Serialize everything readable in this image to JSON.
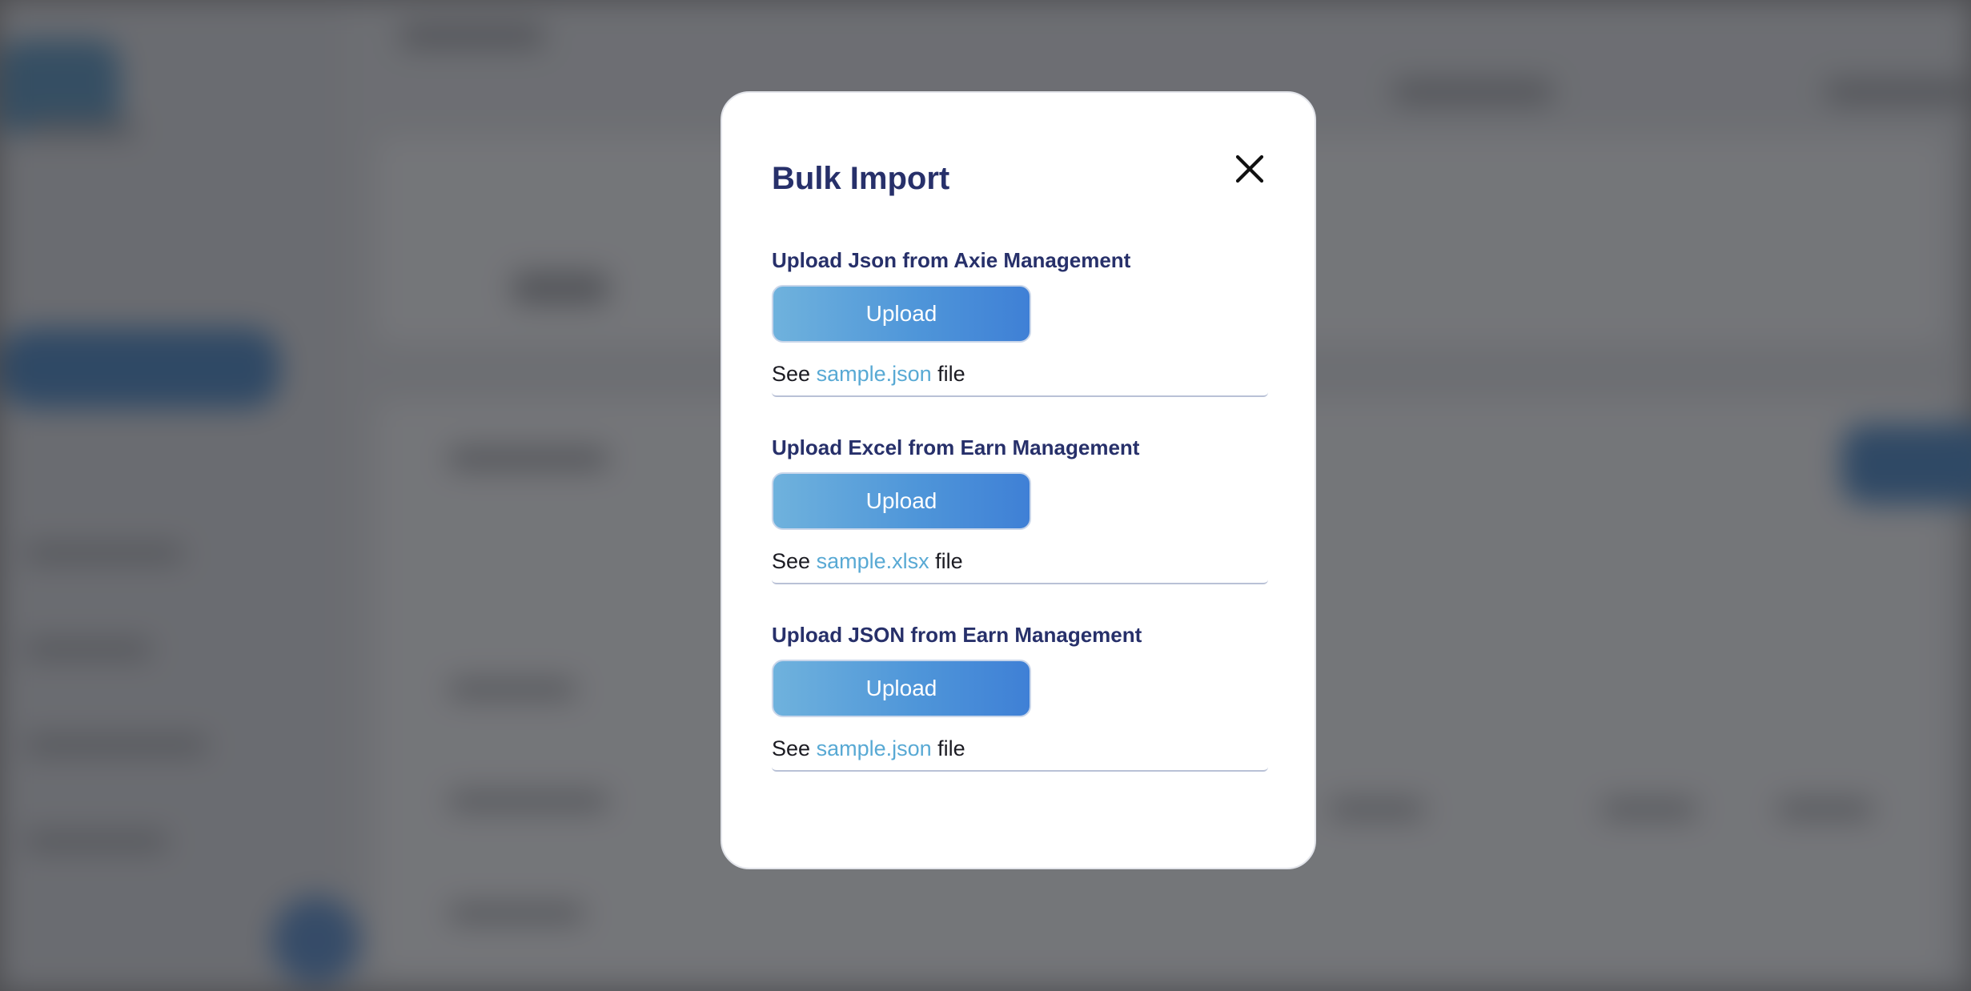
{
  "modal": {
    "title": "Bulk Import",
    "close_icon": "close-icon",
    "sections": [
      {
        "label": "Upload Json from Axie Management",
        "button_label": "Upload",
        "see_prefix": "See",
        "sample_link": "sample.json",
        "see_suffix": "file"
      },
      {
        "label": "Upload Excel from Earn Management",
        "button_label": "Upload",
        "see_prefix": "See",
        "sample_link": "sample.xlsx",
        "see_suffix": "file"
      },
      {
        "label": "Upload JSON from Earn Management",
        "button_label": "Upload",
        "see_prefix": "See",
        "sample_link": "sample.json",
        "see_suffix": "file"
      }
    ]
  },
  "colors": {
    "title": "#27306a",
    "link": "#58a9d4",
    "button_gradient_start": "#6fb2dd",
    "button_gradient_end": "#3f80d6",
    "overlay": "#7a7b7e"
  }
}
